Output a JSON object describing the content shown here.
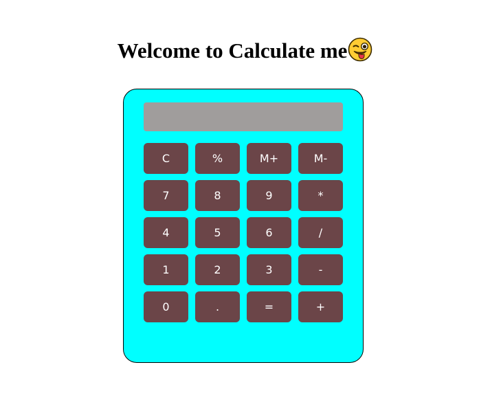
{
  "header": {
    "title": "Welcome to Calculate me",
    "emoji": "winking-face-with-tongue"
  },
  "calculator": {
    "display_value": "",
    "colors": {
      "body": "#00ffff",
      "display": "#a09d9c",
      "key": "#6b4548",
      "key_text": "#ffffff"
    },
    "rows": [
      [
        {
          "label": "C",
          "name": "clear-button"
        },
        {
          "label": "%",
          "name": "percent-button"
        },
        {
          "label": "M+",
          "name": "memory-add-button"
        },
        {
          "label": "M-",
          "name": "memory-subtract-button"
        }
      ],
      [
        {
          "label": "7",
          "name": "digit-7-button"
        },
        {
          "label": "8",
          "name": "digit-8-button"
        },
        {
          "label": "9",
          "name": "digit-9-button"
        },
        {
          "label": "*",
          "name": "multiply-button"
        }
      ],
      [
        {
          "label": "4",
          "name": "digit-4-button"
        },
        {
          "label": "5",
          "name": "digit-5-button"
        },
        {
          "label": "6",
          "name": "digit-6-button"
        },
        {
          "label": "/",
          "name": "divide-button"
        }
      ],
      [
        {
          "label": "1",
          "name": "digit-1-button"
        },
        {
          "label": "2",
          "name": "digit-2-button"
        },
        {
          "label": "3",
          "name": "digit-3-button"
        },
        {
          "label": "-",
          "name": "subtract-button"
        }
      ],
      [
        {
          "label": "0",
          "name": "digit-0-button"
        },
        {
          "label": ".",
          "name": "decimal-point-button"
        },
        {
          "label": "=",
          "name": "equals-button"
        },
        {
          "label": "+",
          "name": "add-button"
        }
      ]
    ]
  }
}
